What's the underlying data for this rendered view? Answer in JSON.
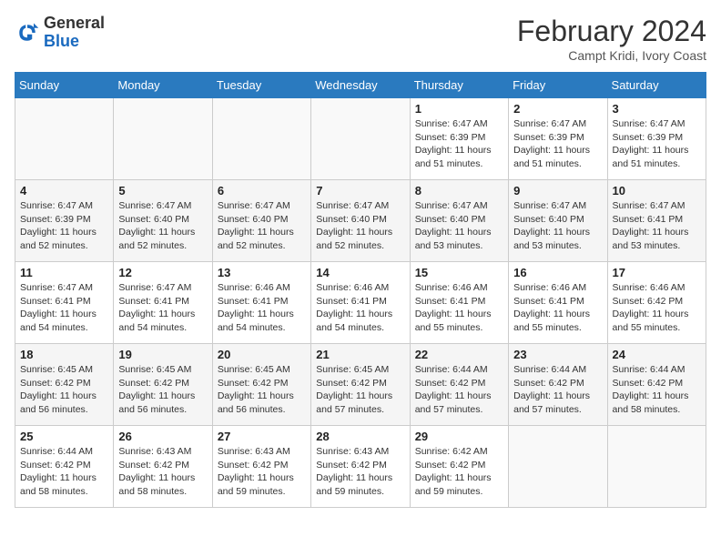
{
  "header": {
    "logo_general": "General",
    "logo_blue": "Blue",
    "month_year": "February 2024",
    "subtitle": "Campt Kridi, Ivory Coast"
  },
  "days_of_week": [
    "Sunday",
    "Monday",
    "Tuesday",
    "Wednesday",
    "Thursday",
    "Friday",
    "Saturday"
  ],
  "weeks": [
    [
      {
        "day": "",
        "info": ""
      },
      {
        "day": "",
        "info": ""
      },
      {
        "day": "",
        "info": ""
      },
      {
        "day": "",
        "info": ""
      },
      {
        "day": "1",
        "info": "Sunrise: 6:47 AM\nSunset: 6:39 PM\nDaylight: 11 hours and 51 minutes."
      },
      {
        "day": "2",
        "info": "Sunrise: 6:47 AM\nSunset: 6:39 PM\nDaylight: 11 hours and 51 minutes."
      },
      {
        "day": "3",
        "info": "Sunrise: 6:47 AM\nSunset: 6:39 PM\nDaylight: 11 hours and 51 minutes."
      }
    ],
    [
      {
        "day": "4",
        "info": "Sunrise: 6:47 AM\nSunset: 6:39 PM\nDaylight: 11 hours and 52 minutes."
      },
      {
        "day": "5",
        "info": "Sunrise: 6:47 AM\nSunset: 6:40 PM\nDaylight: 11 hours and 52 minutes."
      },
      {
        "day": "6",
        "info": "Sunrise: 6:47 AM\nSunset: 6:40 PM\nDaylight: 11 hours and 52 minutes."
      },
      {
        "day": "7",
        "info": "Sunrise: 6:47 AM\nSunset: 6:40 PM\nDaylight: 11 hours and 52 minutes."
      },
      {
        "day": "8",
        "info": "Sunrise: 6:47 AM\nSunset: 6:40 PM\nDaylight: 11 hours and 53 minutes."
      },
      {
        "day": "9",
        "info": "Sunrise: 6:47 AM\nSunset: 6:40 PM\nDaylight: 11 hours and 53 minutes."
      },
      {
        "day": "10",
        "info": "Sunrise: 6:47 AM\nSunset: 6:41 PM\nDaylight: 11 hours and 53 minutes."
      }
    ],
    [
      {
        "day": "11",
        "info": "Sunrise: 6:47 AM\nSunset: 6:41 PM\nDaylight: 11 hours and 54 minutes."
      },
      {
        "day": "12",
        "info": "Sunrise: 6:47 AM\nSunset: 6:41 PM\nDaylight: 11 hours and 54 minutes."
      },
      {
        "day": "13",
        "info": "Sunrise: 6:46 AM\nSunset: 6:41 PM\nDaylight: 11 hours and 54 minutes."
      },
      {
        "day": "14",
        "info": "Sunrise: 6:46 AM\nSunset: 6:41 PM\nDaylight: 11 hours and 54 minutes."
      },
      {
        "day": "15",
        "info": "Sunrise: 6:46 AM\nSunset: 6:41 PM\nDaylight: 11 hours and 55 minutes."
      },
      {
        "day": "16",
        "info": "Sunrise: 6:46 AM\nSunset: 6:41 PM\nDaylight: 11 hours and 55 minutes."
      },
      {
        "day": "17",
        "info": "Sunrise: 6:46 AM\nSunset: 6:42 PM\nDaylight: 11 hours and 55 minutes."
      }
    ],
    [
      {
        "day": "18",
        "info": "Sunrise: 6:45 AM\nSunset: 6:42 PM\nDaylight: 11 hours and 56 minutes."
      },
      {
        "day": "19",
        "info": "Sunrise: 6:45 AM\nSunset: 6:42 PM\nDaylight: 11 hours and 56 minutes."
      },
      {
        "day": "20",
        "info": "Sunrise: 6:45 AM\nSunset: 6:42 PM\nDaylight: 11 hours and 56 minutes."
      },
      {
        "day": "21",
        "info": "Sunrise: 6:45 AM\nSunset: 6:42 PM\nDaylight: 11 hours and 57 minutes."
      },
      {
        "day": "22",
        "info": "Sunrise: 6:44 AM\nSunset: 6:42 PM\nDaylight: 11 hours and 57 minutes."
      },
      {
        "day": "23",
        "info": "Sunrise: 6:44 AM\nSunset: 6:42 PM\nDaylight: 11 hours and 57 minutes."
      },
      {
        "day": "24",
        "info": "Sunrise: 6:44 AM\nSunset: 6:42 PM\nDaylight: 11 hours and 58 minutes."
      }
    ],
    [
      {
        "day": "25",
        "info": "Sunrise: 6:44 AM\nSunset: 6:42 PM\nDaylight: 11 hours and 58 minutes."
      },
      {
        "day": "26",
        "info": "Sunrise: 6:43 AM\nSunset: 6:42 PM\nDaylight: 11 hours and 58 minutes."
      },
      {
        "day": "27",
        "info": "Sunrise: 6:43 AM\nSunset: 6:42 PM\nDaylight: 11 hours and 59 minutes."
      },
      {
        "day": "28",
        "info": "Sunrise: 6:43 AM\nSunset: 6:42 PM\nDaylight: 11 hours and 59 minutes."
      },
      {
        "day": "29",
        "info": "Sunrise: 6:42 AM\nSunset: 6:42 PM\nDaylight: 11 hours and 59 minutes."
      },
      {
        "day": "",
        "info": ""
      },
      {
        "day": "",
        "info": ""
      }
    ]
  ]
}
